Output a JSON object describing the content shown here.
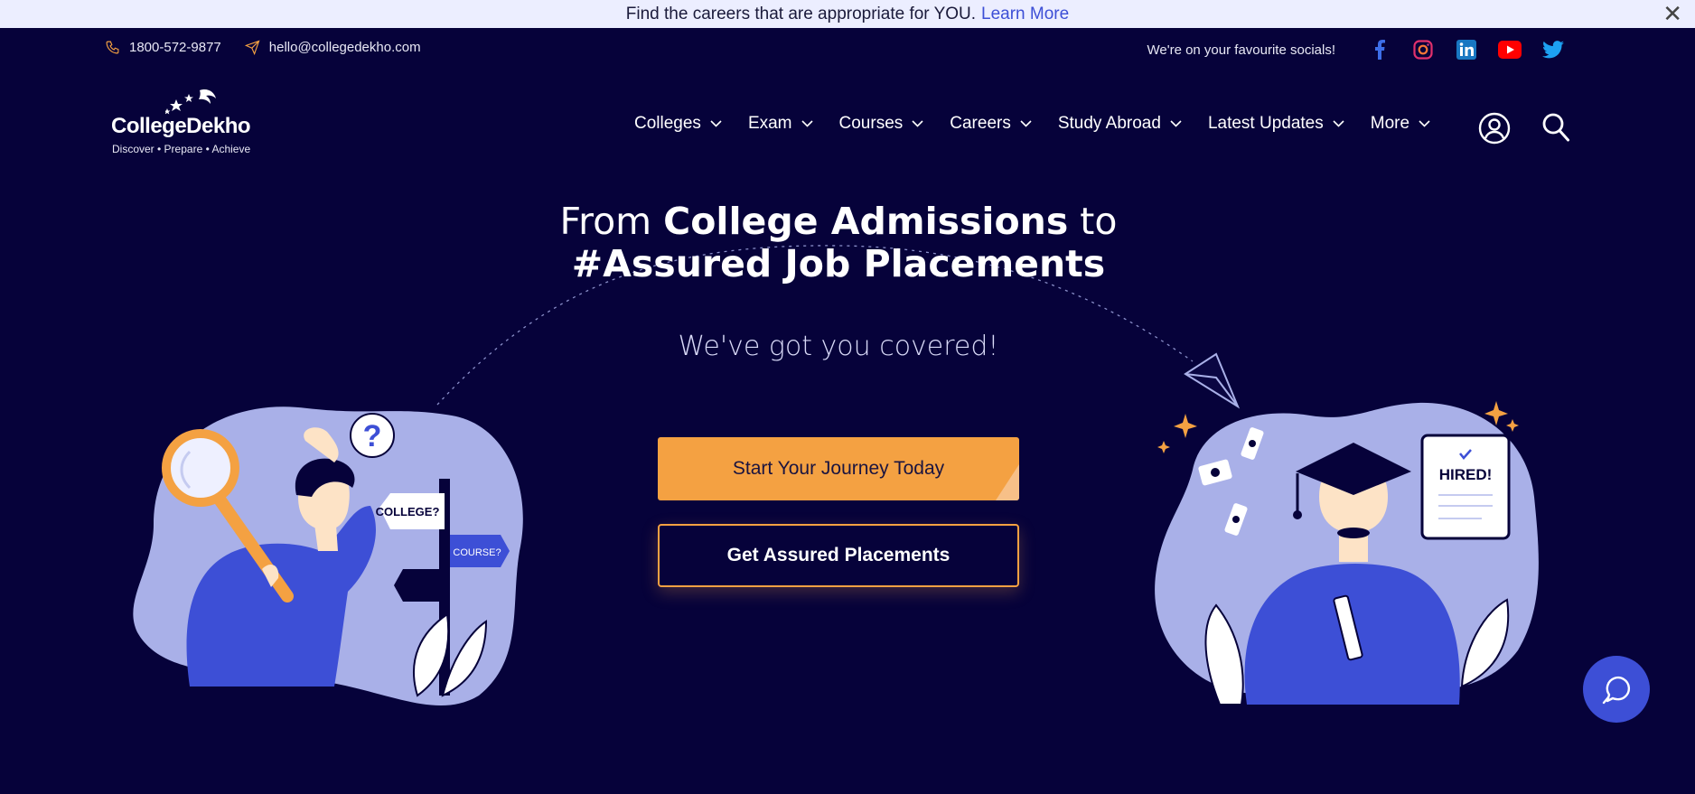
{
  "announcement": {
    "text": "Find the careers that are appropriate for YOU.",
    "link": "Learn More",
    "close": "✕"
  },
  "contact": {
    "phone": "1800-572-9877",
    "email": "hello@collegedekho.com"
  },
  "socials": {
    "label": "We're on your favourite socials!",
    "items": [
      "facebook-icon",
      "instagram-icon",
      "linkedin-icon",
      "youtube-icon",
      "twitter-icon"
    ]
  },
  "logo": {
    "name": "CollegeDekho",
    "tagline": "Discover  •  Prepare  •  Achieve"
  },
  "nav": {
    "items": [
      "Colleges",
      "Exam",
      "Courses",
      "Careers",
      "Study Abroad",
      "Latest Updates",
      "More"
    ]
  },
  "hero": {
    "line1_pre": "From ",
    "line1_bold": "College Admissions",
    "line1_post": " to",
    "line2": "#Assured Job Placements",
    "subtitle": "We've got you covered!",
    "cta_primary": "Start Your Journey Today",
    "cta_secondary": "Get Assured Placements"
  },
  "illustration_left": {
    "sign1": "COLLEGE?",
    "sign2": "COURSE?",
    "question": "?"
  },
  "illustration_right": {
    "paper": "HIRED!"
  },
  "colors": {
    "bg": "#06023a",
    "accent": "#f4a142",
    "blue": "#3d4fd6",
    "blob": "#a9b0e8"
  }
}
